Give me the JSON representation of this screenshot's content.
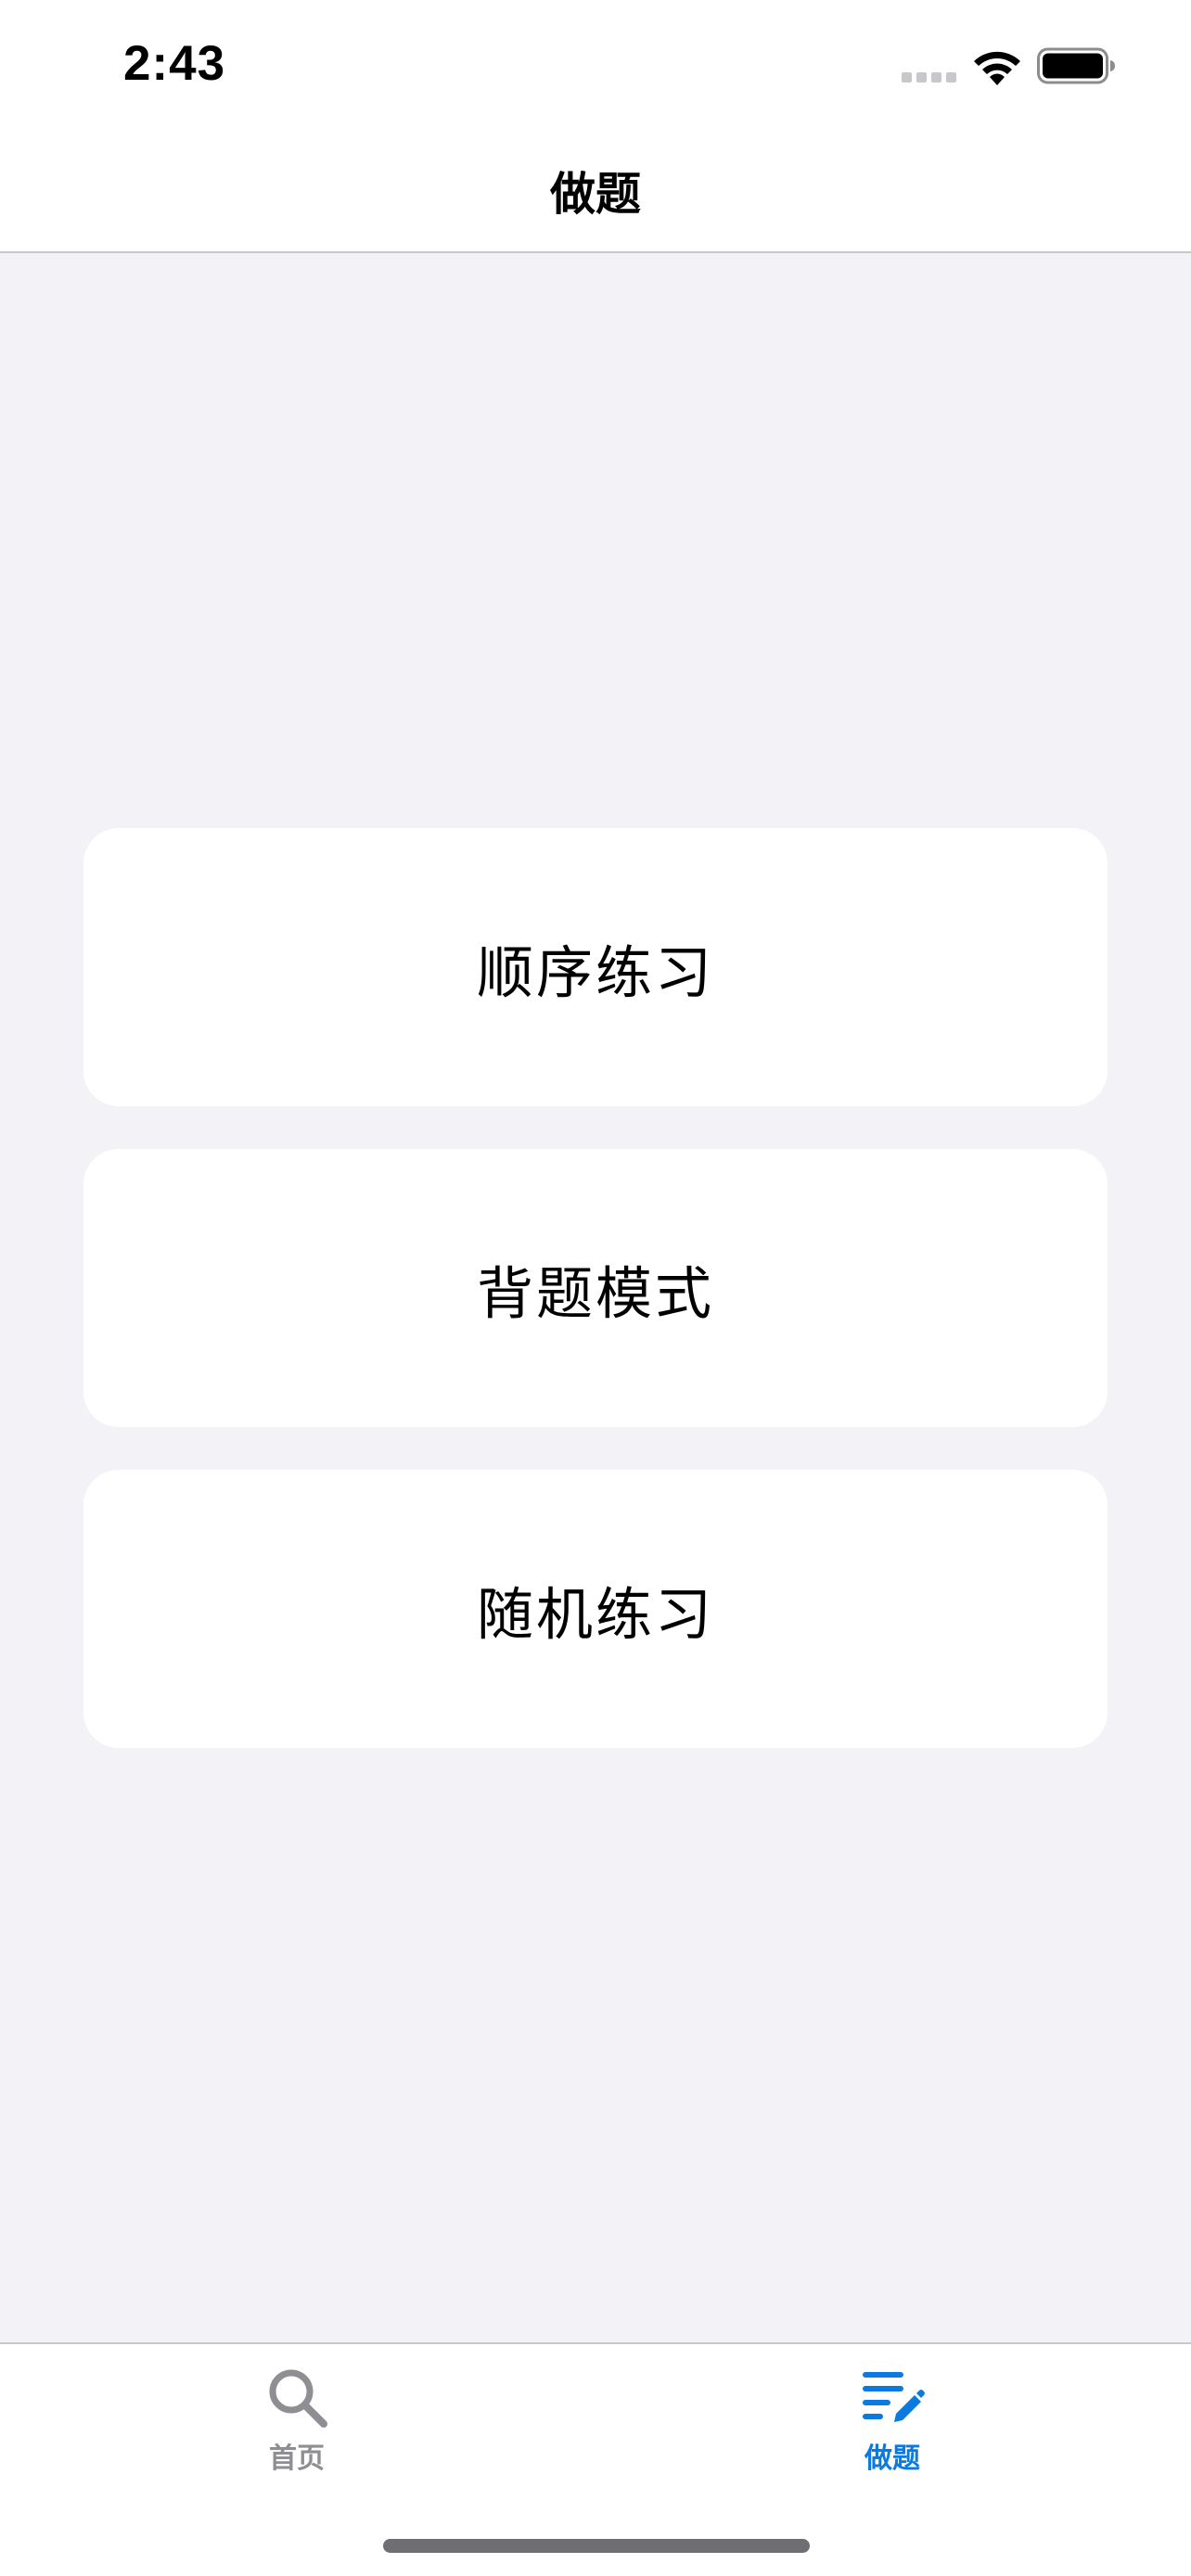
{
  "status_bar": {
    "time": "2:43",
    "icons": [
      "cellular-signal-icon",
      "wifi-icon",
      "battery-icon"
    ]
  },
  "nav": {
    "title": "做题"
  },
  "menu": {
    "items": [
      {
        "label": "顺序练习"
      },
      {
        "label": "背题模式"
      },
      {
        "label": "随机练习"
      }
    ]
  },
  "tab_bar": {
    "items": [
      {
        "label": "首页",
        "icon": "search-icon",
        "selected": false
      },
      {
        "label": "做题",
        "icon": "list-edit-icon",
        "selected": true
      }
    ]
  },
  "colors": {
    "background": "#F2F2F7",
    "card": "#FFFFFF",
    "accent": "#0A7AE0",
    "inactive": "#8E8E93"
  }
}
